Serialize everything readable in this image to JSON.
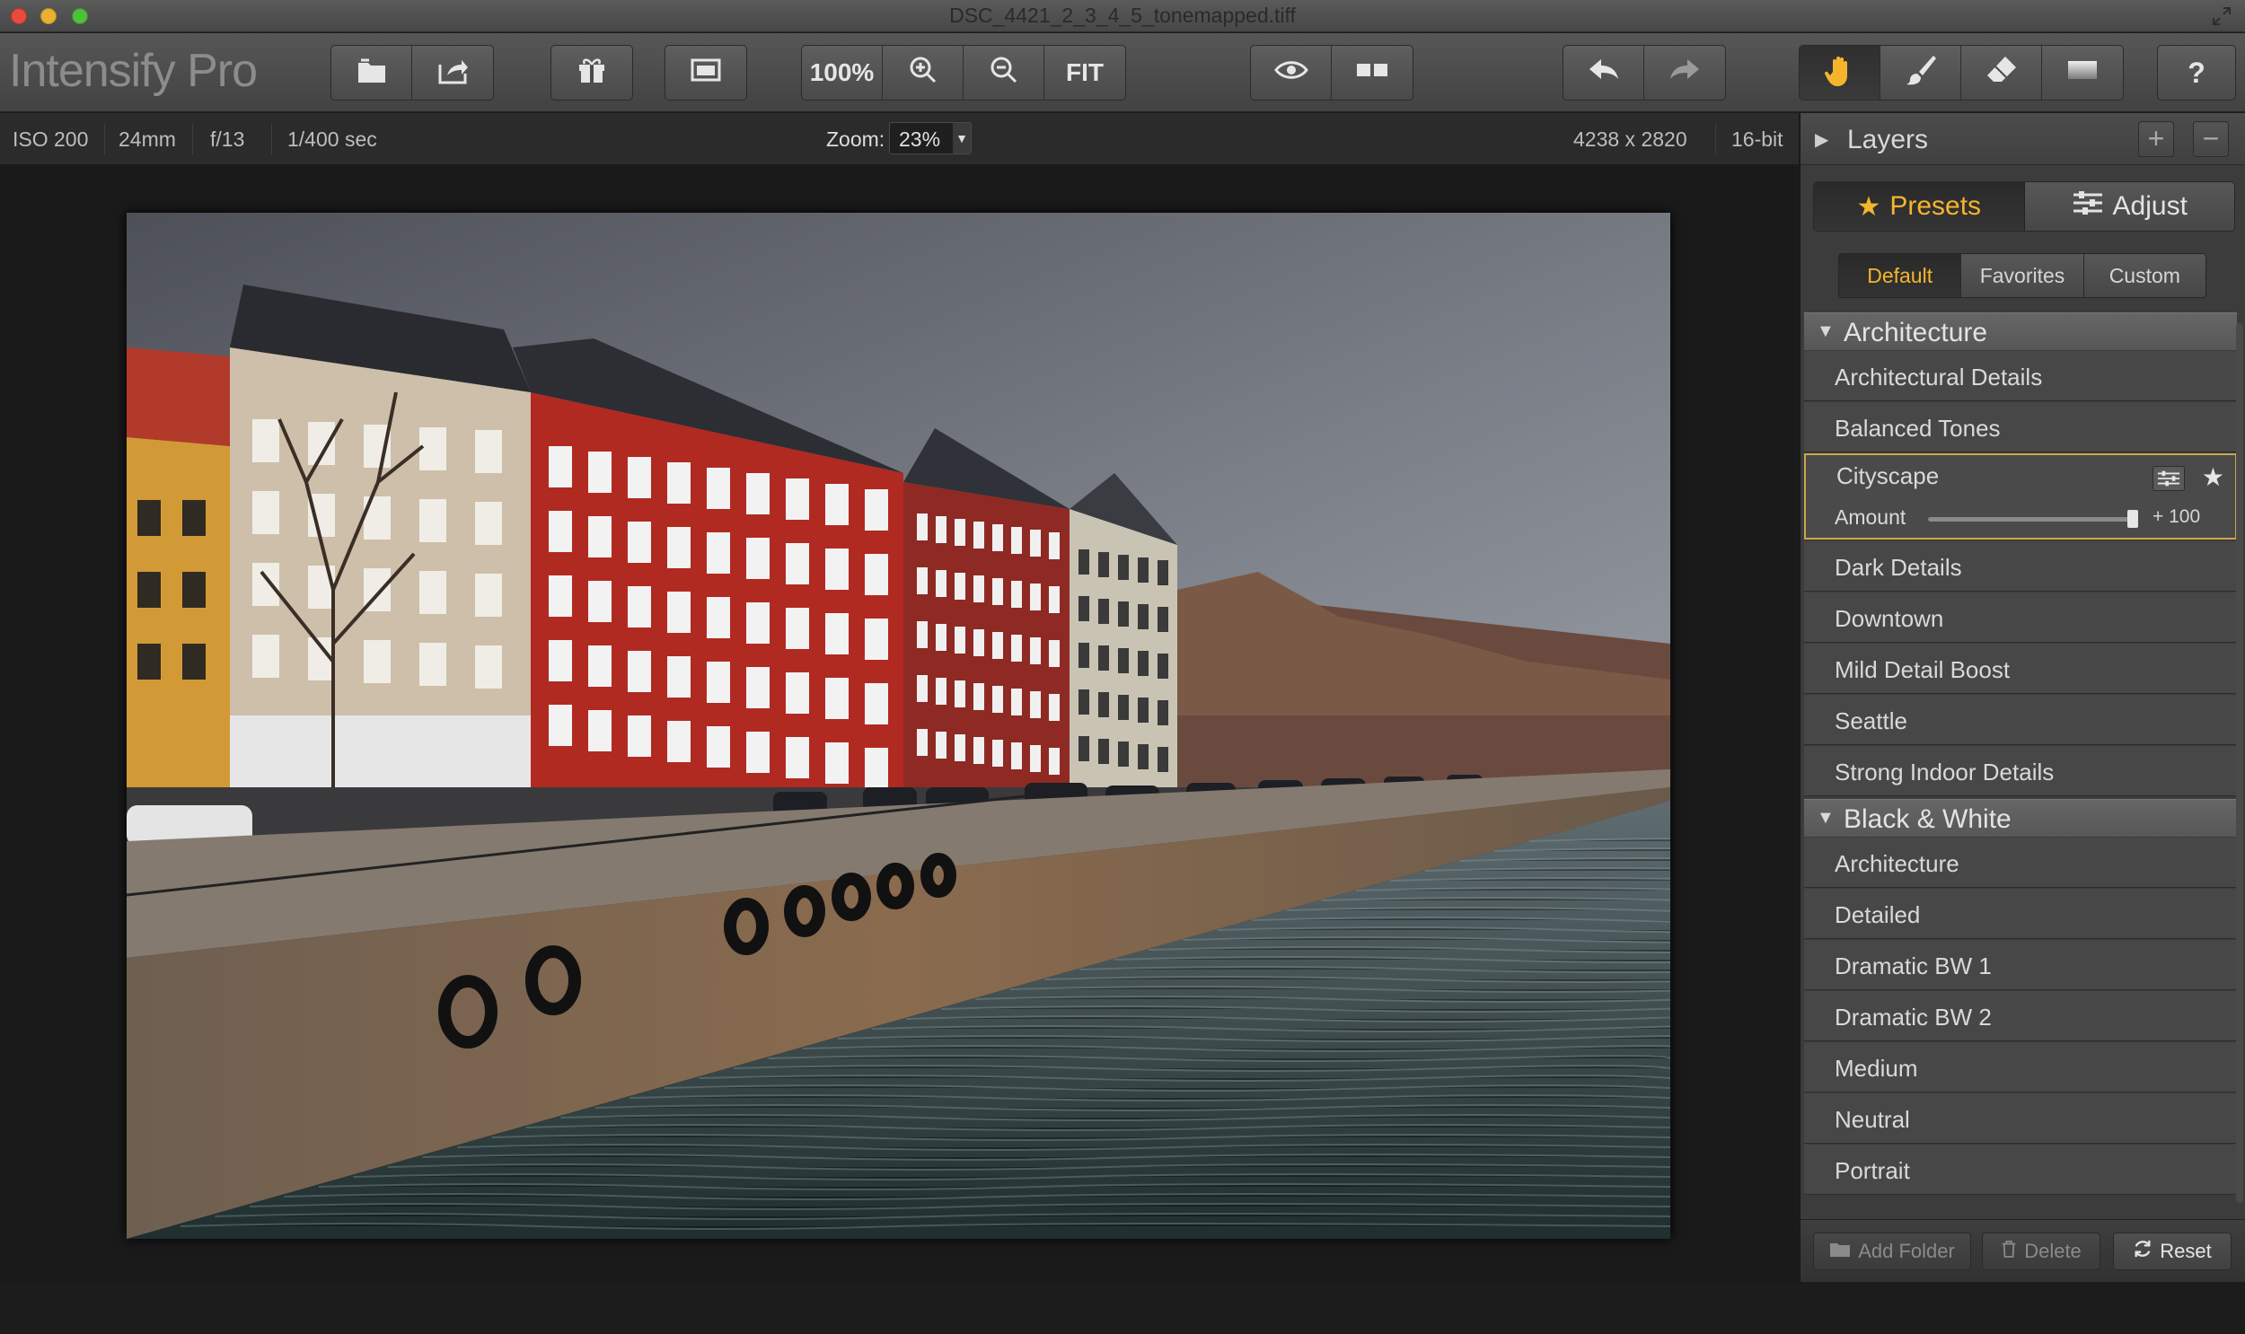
{
  "window": {
    "title": "DSC_4421_2_3_4_5_tonemapped.tiff"
  },
  "app": {
    "name": "Intensify Pro"
  },
  "toolbar": {
    "zoom100_label": "100%",
    "fit_label": "FIT",
    "icons": [
      "open-icon",
      "export-icon",
      "gift-icon",
      "window-icon",
      "zoom-in-icon",
      "zoom-out-icon",
      "eye-icon",
      "split-view-icon",
      "undo-icon",
      "redo-icon",
      "hand-icon",
      "brush-icon",
      "eraser-icon",
      "gradient-icon",
      "help-icon"
    ]
  },
  "info": {
    "iso": "ISO 200",
    "focal": "24mm",
    "aperture": "f/13",
    "shutter": "1/400 sec",
    "zoom_label": "Zoom:",
    "zoom_value": "23%",
    "dimensions": "4238 x 2820",
    "bit_depth": "16-bit"
  },
  "panel": {
    "layers_title": "Layers",
    "presets_label": "Presets",
    "adjust_label": "Adjust",
    "tabs": [
      {
        "label": "Default",
        "active": true
      },
      {
        "label": "Favorites",
        "active": false
      },
      {
        "label": "Custom",
        "active": false
      }
    ],
    "categories": [
      {
        "label": "Architecture",
        "items": [
          "Architectural Details",
          "Balanced Tones",
          "Cityscape",
          "Dark Details",
          "Downtown",
          "Mild Detail Boost",
          "Seattle",
          "Strong Indoor Details"
        ]
      },
      {
        "label": "Black & White",
        "items": [
          "Architecture",
          "Detailed",
          "Dramatic BW 1",
          "Dramatic BW 2",
          "Medium",
          "Neutral",
          "Portrait"
        ]
      }
    ],
    "selected": {
      "name": "Cityscape",
      "amount_label": "Amount",
      "amount_value": "+ 100",
      "amount_fraction": 1.0
    },
    "bottom": {
      "add_folder": "Add Folder",
      "delete": "Delete",
      "reset": "Reset"
    }
  },
  "colors": {
    "accent": "#f4b52d",
    "selection_border": "#c9a84a"
  }
}
